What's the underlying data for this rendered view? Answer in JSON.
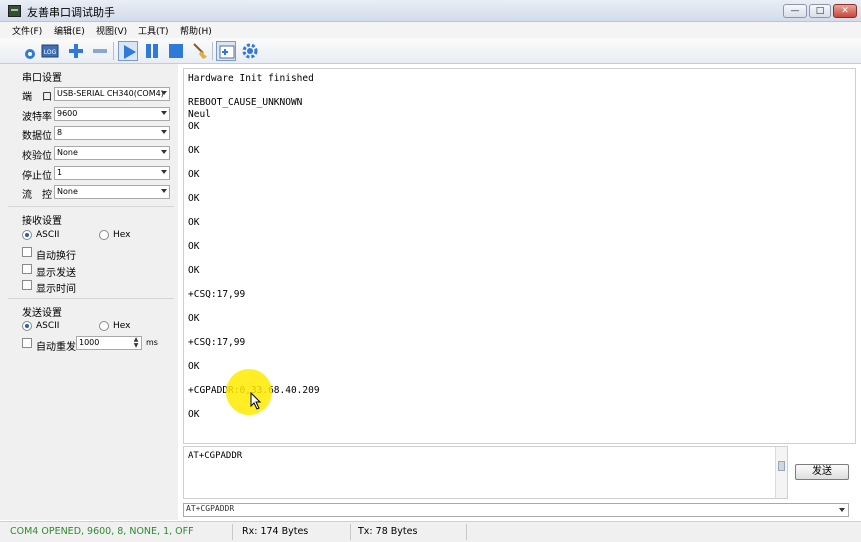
{
  "window": {
    "title": "友善串口调试助手",
    "min": "—",
    "max": "□",
    "close": "✕"
  },
  "menu": [
    "文件(F)",
    "编辑(E)",
    "视图(V)",
    "工具(T)",
    "帮助(H)"
  ],
  "toolbar": {
    "log_label": "LOG",
    "icons": [
      "new-session-icon",
      "log-icon",
      "add-icon",
      "remove-icon",
      "play-icon",
      "pause-icon",
      "stop-icon",
      "clear-icon",
      "add-window-icon",
      "settings-gear-icon"
    ]
  },
  "serial_settings": {
    "title": "串口设置",
    "port_label": "端　口",
    "port_value": "USB-SERIAL CH340(COM4)",
    "baud_label": "波特率",
    "baud_value": "9600",
    "databits_label": "数据位",
    "databits_value": "8",
    "parity_label": "校验位",
    "parity_value": "None",
    "stopbits_label": "停止位",
    "stopbits_value": "1",
    "flow_label": "流　控",
    "flow_value": "None"
  },
  "receive_settings": {
    "title": "接收设置",
    "ascii": "ASCII",
    "hex": "Hex",
    "auto_newline": "自动换行",
    "show_send": "显示发送",
    "show_time": "显示时间"
  },
  "send_settings": {
    "title": "发送设置",
    "ascii": "ASCII",
    "hex": "Hex",
    "auto_repeat": "自动重发",
    "interval_value": "1000",
    "interval_unit": "ms"
  },
  "receive_lines": [
    "Hardware Init finished",
    "",
    "REBOOT_CAUSE_UNKNOWN",
    "Neul",
    "OK",
    "",
    "OK",
    "",
    "OK",
    "",
    "OK",
    "",
    "OK",
    "",
    "OK",
    "",
    "OK",
    "",
    "+CSQ:17,99",
    "",
    "OK",
    "",
    "+CSQ:17,99",
    "",
    "OK",
    "",
    "+CGPADDR:0,33.68.40.209",
    "",
    "OK"
  ],
  "send": {
    "text": "AT+CGPADDR",
    "button": "发送",
    "history_value": "AT+CGPADDR"
  },
  "status": {
    "port": "COM4 OPENED, 9600, 8, NONE, 1, OFF",
    "rx": "Rx: 174 Bytes",
    "tx": "Tx: 78 Bytes"
  },
  "colors": {
    "status_ok": "#2e8b2e",
    "highlight": "#ffeb00"
  }
}
